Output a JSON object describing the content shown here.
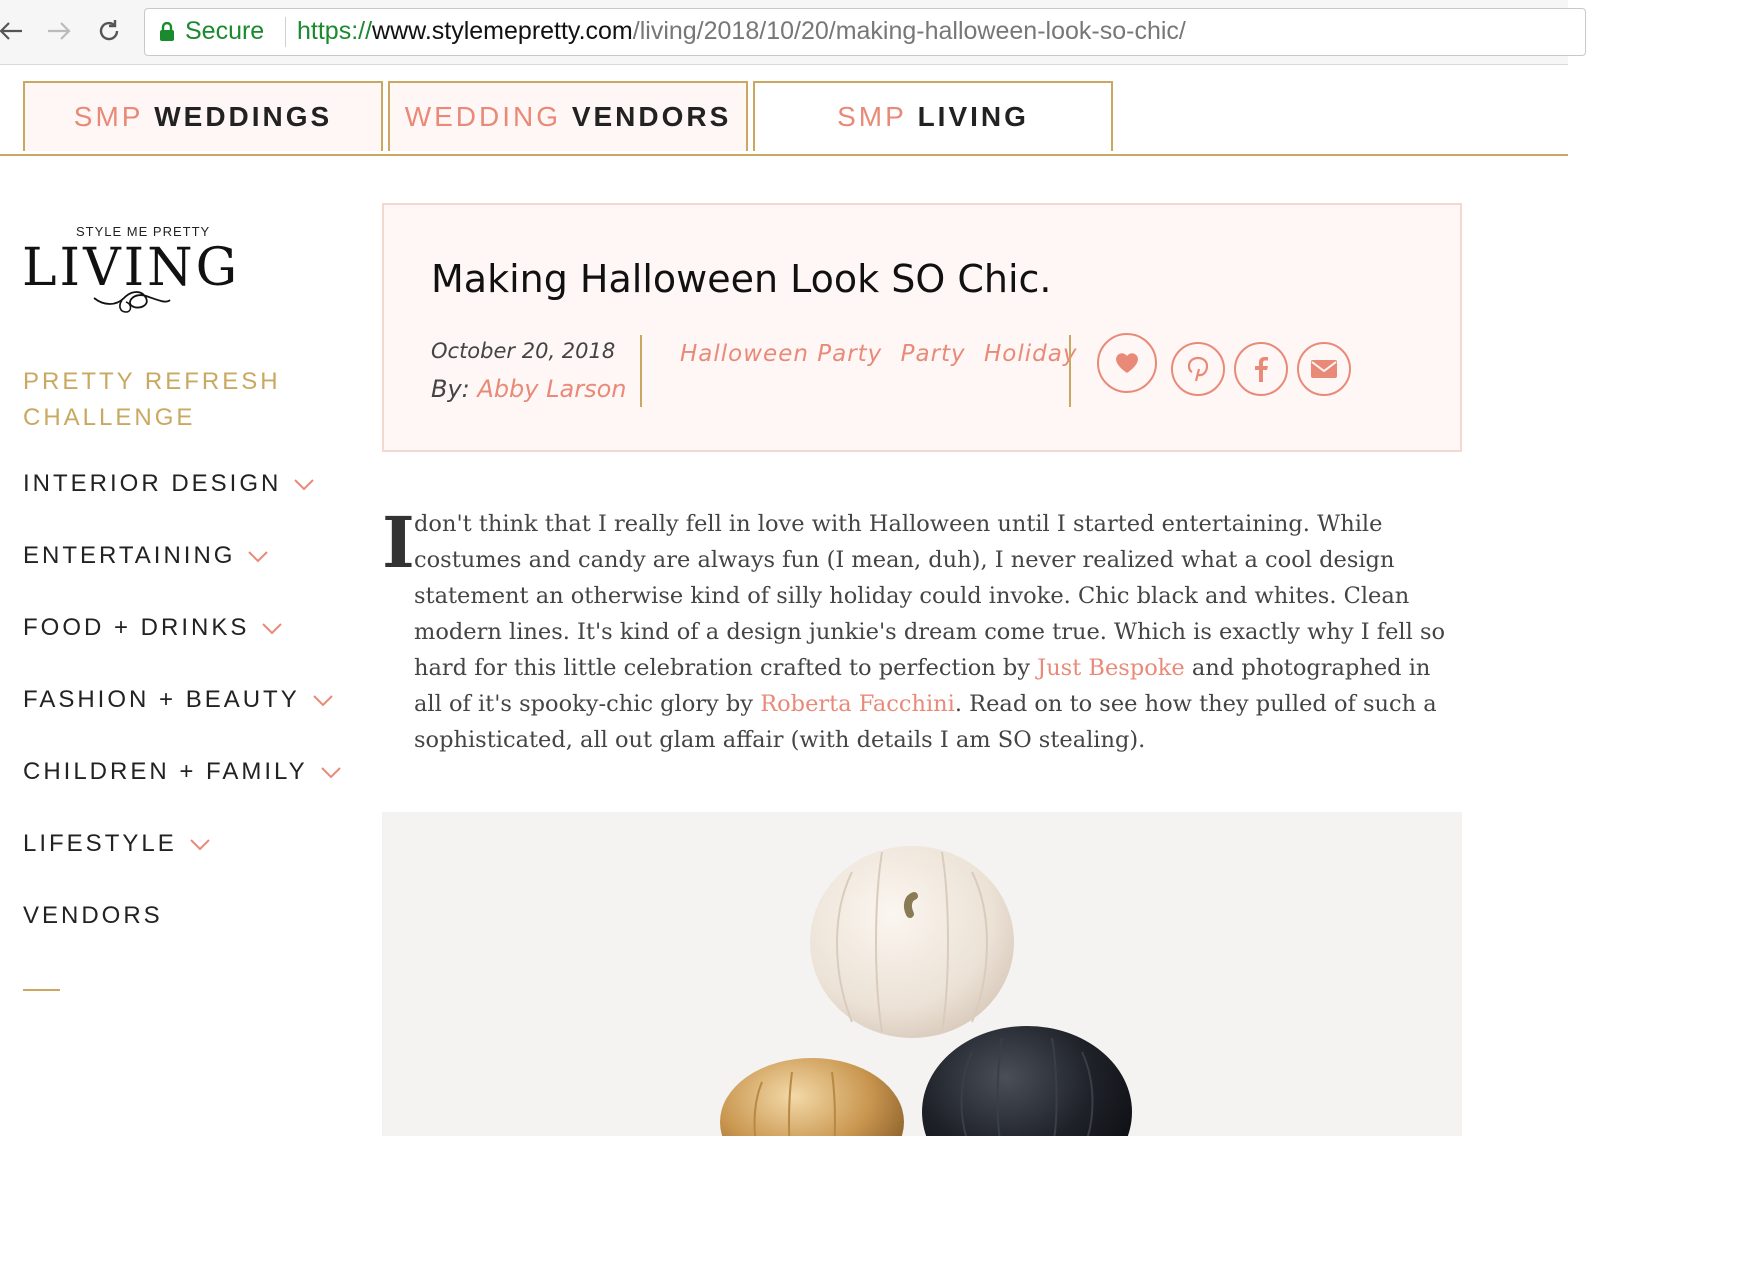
{
  "browser": {
    "secure_label": "Secure",
    "url_scheme": "https://",
    "url_host": "www.stylemepretty.com",
    "url_path": "/living/2018/10/20/making-halloween-look-so-chic/"
  },
  "site_tabs": [
    {
      "prefix": "SMP",
      "name": "WEDDINGS"
    },
    {
      "prefix": "WEDDING",
      "name": "VENDORS"
    },
    {
      "prefix": "SMP",
      "name": "LIVING"
    }
  ],
  "logo": {
    "small": "STYLE ME PRETTY",
    "big": "LIVING"
  },
  "sidebar": {
    "challenge": [
      "PRETTY REFRESH",
      "CHALLENGE"
    ],
    "items": [
      {
        "label": "INTERIOR DESIGN",
        "chevron": true
      },
      {
        "label": "ENTERTAINING",
        "chevron": true
      },
      {
        "label": "FOOD + DRINKS",
        "chevron": true
      },
      {
        "label": "FASHION + BEAUTY",
        "chevron": true
      },
      {
        "label": "CHILDREN + FAMILY",
        "chevron": true
      },
      {
        "label": "LIFESTYLE",
        "chevron": true
      },
      {
        "label": "VENDORS",
        "chevron": false
      }
    ]
  },
  "article": {
    "title": "Making Halloween Look SO Chic.",
    "date": "October 20, 2018",
    "by_label": "By:",
    "author": "Abby Larson",
    "tags": [
      "Halloween Party",
      "Party",
      "Holiday"
    ],
    "dropcap": "I",
    "body_part1": "don't think that I really fell in love with Halloween until I started entertaining. While costumes and candy are always fun (I mean, duh), I never realized what a cool design statement an otherwise kind of silly holiday could invoke. Chic black and whites. Clean modern lines. It's kind of a design junkie's dream come true. Which is exactly why I fell so hard for this little celebration crafted to perfection by",
    "link1": "Just Bespoke",
    "body_part2": "and photographed in all of it's spooky-chic glory by",
    "link2": "Roberta Facchini",
    "body_part3": ". Read on to see how they pulled of such a sophisticated, all out glam affair (with details I am SO stealing)."
  },
  "colors": {
    "accent_coral": "#e98a78",
    "accent_gold": "#c9a961",
    "header_bg": "#fff7f5"
  }
}
